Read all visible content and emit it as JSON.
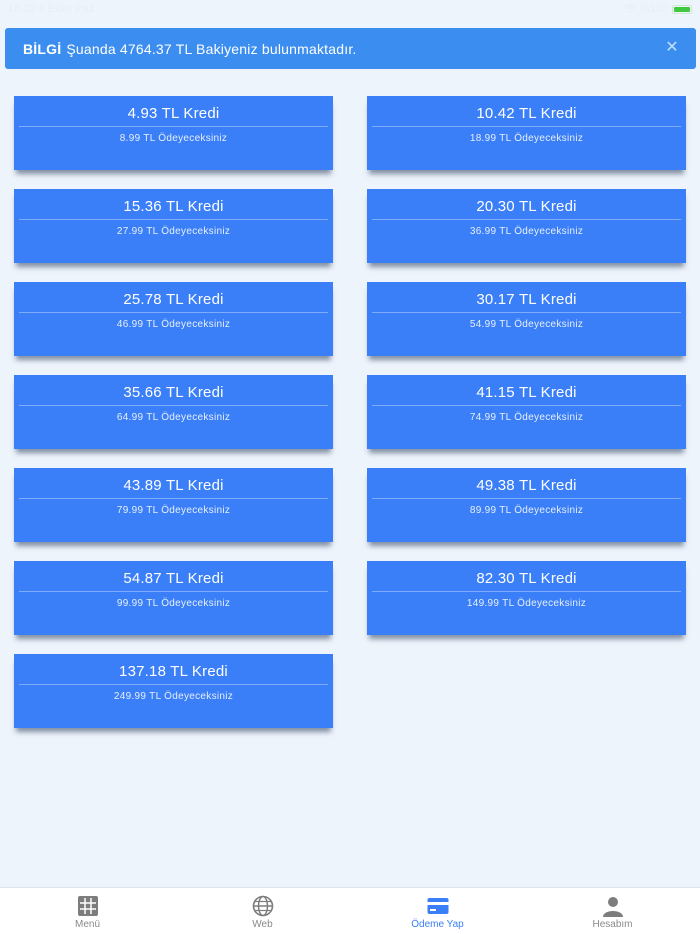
{
  "status_bar": {
    "time_date": "16:29   4 Ekim Paz",
    "battery": "%100"
  },
  "alert": {
    "strong": "BİLGİ",
    "message": "Şuanda 4764.37 TL Bakiyeniz bulunmaktadır.",
    "close_symbol": "✕"
  },
  "packages": [
    {
      "credit": "4.93 TL Kredi",
      "price": "8.99 TL Ödeyeceksiniz"
    },
    {
      "credit": "10.42 TL Kredi",
      "price": "18.99 TL Ödeyeceksiniz"
    },
    {
      "credit": "15.36 TL Kredi",
      "price": "27.99 TL Ödeyeceksiniz"
    },
    {
      "credit": "20.30 TL Kredi",
      "price": "36.99 TL Ödeyeceksiniz"
    },
    {
      "credit": "25.78 TL Kredi",
      "price": "46.99 TL Ödeyeceksiniz"
    },
    {
      "credit": "30.17 TL Kredi",
      "price": "54.99 TL Ödeyeceksiniz"
    },
    {
      "credit": "35.66 TL Kredi",
      "price": "64.99 TL Ödeyeceksiniz"
    },
    {
      "credit": "41.15 TL Kredi",
      "price": "74.99 TL Ödeyeceksiniz"
    },
    {
      "credit": "43.89 TL Kredi",
      "price": "79.99 TL Ödeyeceksiniz"
    },
    {
      "credit": "49.38 TL Kredi",
      "price": "89.99 TL Ödeyeceksiniz"
    },
    {
      "credit": "54.87 TL Kredi",
      "price": "99.99 TL Ödeyeceksiniz"
    },
    {
      "credit": "82.30 TL Kredi",
      "price": "149.99 TL Ödeyeceksiniz"
    },
    {
      "credit": "137.18 TL Kredi",
      "price": "249.99 TL Ödeyeceksiniz"
    }
  ],
  "tabs": [
    {
      "label": "Menü",
      "icon": "grid-icon",
      "active": false
    },
    {
      "label": "Web",
      "icon": "globe-icon",
      "active": false
    },
    {
      "label": "Ödeme Yap",
      "icon": "credit-card-icon",
      "active": true
    },
    {
      "label": "Hesabım",
      "icon": "user-icon",
      "active": false
    }
  ],
  "colors": {
    "background": "#eef4fc",
    "alert": "#3b8df0",
    "card": "#3a7ff7",
    "tab_active": "#3a7ff7",
    "tab_inactive": "#8a8a8a"
  }
}
